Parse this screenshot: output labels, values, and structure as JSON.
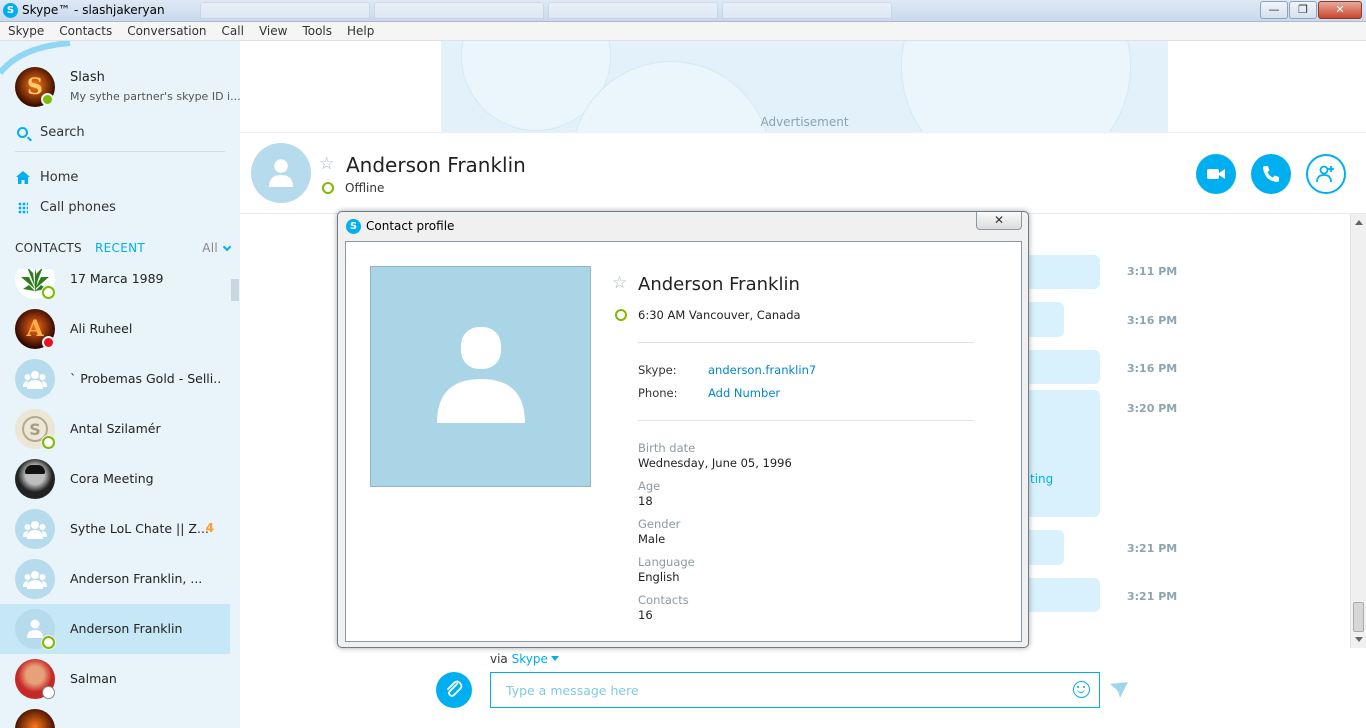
{
  "window": {
    "title": "Skype™ - slashjakeryan",
    "app_glyph": "S"
  },
  "menu": [
    "Skype",
    "Contacts",
    "Conversation",
    "Call",
    "View",
    "Tools",
    "Help"
  ],
  "profile": {
    "name": "Slash",
    "mood": "My sythe partner's skype ID i...",
    "avatar_letter": "S"
  },
  "sidebar": {
    "search_label": "Search",
    "nav": {
      "home": "Home",
      "call_phones": "Call phones"
    },
    "tabs": {
      "contacts": "CONTACTS",
      "recent": "RECENT",
      "filter": "All"
    }
  },
  "contacts": [
    {
      "name": "17 Marca 1989",
      "status": "online-ring",
      "avatar": "leaf"
    },
    {
      "name": "Ali Ruheel",
      "status": "busy",
      "avatar": "letter-a"
    },
    {
      "name": "` Probemas Gold - Selli...",
      "status": "none",
      "avatar": "group"
    },
    {
      "name": "Antal Szilamér",
      "status": "online-ring",
      "avatar": "skype-logo"
    },
    {
      "name": "Cora Meeting",
      "status": "none",
      "avatar": "photo-dark"
    },
    {
      "name": "Sythe LoL Chate || Z...",
      "status": "none",
      "avatar": "group",
      "badge": "4"
    },
    {
      "name": "Anderson Franklin, ...",
      "status": "none",
      "avatar": "group"
    },
    {
      "name": "Anderson Franklin",
      "status": "online-ring",
      "avatar": "person",
      "selected": true
    },
    {
      "name": "Salman",
      "status": "away",
      "avatar": "photo-red"
    }
  ],
  "ad": {
    "label": "Advertisement"
  },
  "chat_header": {
    "name": "Anderson Franklin",
    "status": "Offline"
  },
  "chat": {
    "timestamps": [
      "3:11 PM",
      "3:16 PM",
      "3:16 PM",
      "3:20 PM",
      "3:21 PM",
      "3:21 PM"
    ],
    "link_fragment": "ting"
  },
  "compose": {
    "via_label": "via",
    "via_service": "Skype",
    "placeholder": "Type a message here"
  },
  "dialog": {
    "title": "Contact profile",
    "close_glyph": "✕",
    "name": "Anderson Franklin",
    "local_time": "6:30 AM Vancouver, Canada",
    "skype_label": "Skype:",
    "skype_id": "anderson.franklin7",
    "phone_label": "Phone:",
    "phone_action": "Add Number",
    "fields": [
      {
        "label": "Birth date",
        "value": "Wednesday, June 05, 1996"
      },
      {
        "label": "Age",
        "value": "18"
      },
      {
        "label": "Gender",
        "value": "Male"
      },
      {
        "label": "Language",
        "value": "English"
      },
      {
        "label": "Contacts",
        "value": "16"
      }
    ]
  },
  "colors": {
    "accent": "#00aff0",
    "online": "#7fba00",
    "busy": "#e81123",
    "sidebar_bg": "#e8f3fa"
  }
}
